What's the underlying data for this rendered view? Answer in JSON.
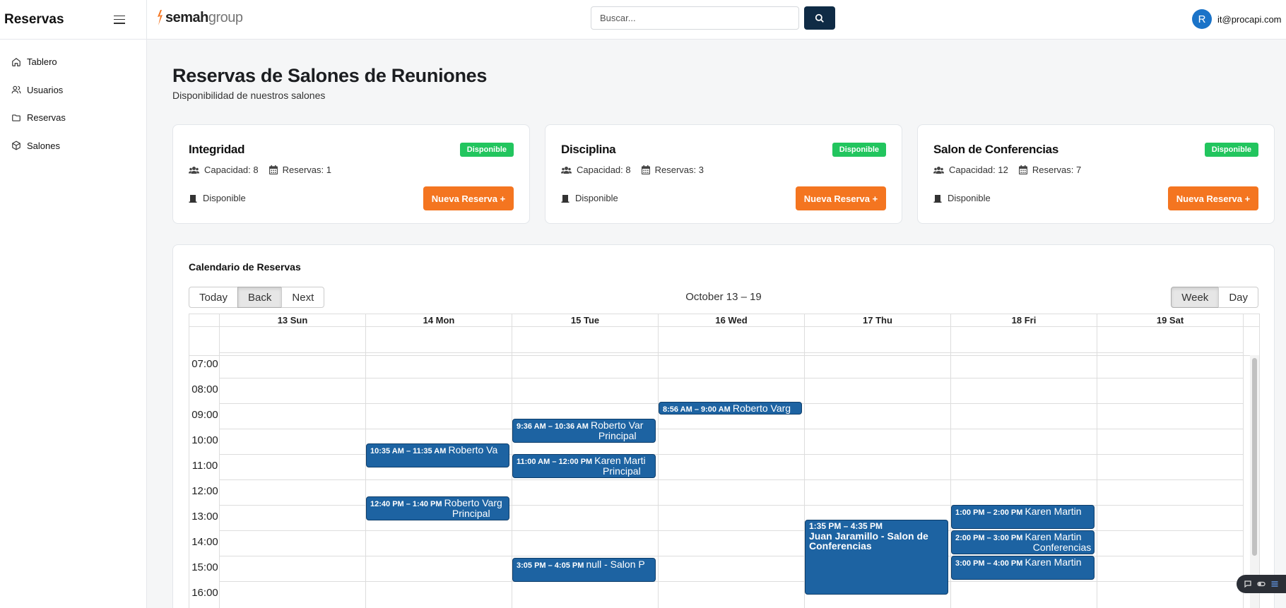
{
  "sidebar": {
    "title": "Reservas",
    "items": [
      {
        "label": "Tablero",
        "icon": "home-icon"
      },
      {
        "label": "Usuarios",
        "icon": "users-icon"
      },
      {
        "label": "Reservas",
        "icon": "folder-icon"
      },
      {
        "label": "Salones",
        "icon": "cube-icon"
      }
    ]
  },
  "topbar": {
    "logo_bold": "semah",
    "logo_light": "group",
    "search_placeholder": "Buscar...",
    "user_initial": "R",
    "user_email": "it@procapi.com"
  },
  "main": {
    "title": "Reservas de Salones de Reuniones",
    "subtitle": "Disponibilidad de nuestros salones"
  },
  "rooms": [
    {
      "name": "Integridad",
      "badge": "Disponible",
      "capacity": "Capacidad: 8",
      "reservations": "Reservas: 1",
      "status": "Disponible",
      "button": "Nueva Reserva +"
    },
    {
      "name": "Disciplina",
      "badge": "Disponible",
      "capacity": "Capacidad: 8",
      "reservations": "Reservas: 3",
      "status": "Disponible",
      "button": "Nueva Reserva +"
    },
    {
      "name": "Salon de Conferencias",
      "badge": "Disponible",
      "capacity": "Capacidad: 12",
      "reservations": "Reservas: 7",
      "status": "Disponible",
      "button": "Nueva Reserva +"
    }
  ],
  "calendar": {
    "title": "Calendario de Reservas",
    "nav_buttons": [
      "Today",
      "Back",
      "Next"
    ],
    "range": "October 13 – 19",
    "view_buttons": [
      "Week",
      "Day"
    ],
    "active_view": "Week",
    "days": [
      "13 Sun",
      "14 Mon",
      "15 Tue",
      "16 Wed",
      "17 Thu",
      "18 Fri",
      "19 Sat"
    ],
    "hours": [
      "07:00",
      "08:00",
      "09:00",
      "10:00",
      "11:00",
      "12:00",
      "13:00",
      "14:00",
      "15:00",
      "16:00"
    ],
    "events": [
      {
        "day": 3,
        "start": 8.933,
        "end": 9.5,
        "time": "8:56 AM – 9:00 AM",
        "title": "Roberto Varg",
        "style": "inline"
      },
      {
        "day": 2,
        "start": 9.6,
        "end": 10.6,
        "time": "9:36 AM – 10:36 AM",
        "title": "Roberto Var",
        "title2": "Principal",
        "style": "inline"
      },
      {
        "day": 1,
        "start": 10.583,
        "end": 11.583,
        "time": "10:35 AM – 11:35 AM",
        "title": "Roberto Va",
        "style": "inline"
      },
      {
        "day": 2,
        "start": 11.0,
        "end": 12.0,
        "time": "11:00 AM – 12:00 PM",
        "title": "Karen Marti",
        "title2": "Principal",
        "style": "inline"
      },
      {
        "day": 1,
        "start": 12.667,
        "end": 13.667,
        "time": "12:40 PM – 1:40 PM",
        "title": "Roberto Varg",
        "title2": "Principal",
        "style": "inline"
      },
      {
        "day": 4,
        "start": 13.583,
        "end": 16.583,
        "time": "1:35 PM – 4:35 PM",
        "title": "Juan Jaramillo - Salon de Conferencias",
        "style": "tall"
      },
      {
        "day": 5,
        "start": 13.0,
        "end": 14.0,
        "time": "1:00 PM – 2:00 PM",
        "title": "Karen Martin",
        "style": "inline"
      },
      {
        "day": 5,
        "start": 14.0,
        "end": 15.0,
        "time": "2:00 PM – 3:00 PM",
        "title": "Karen Martin",
        "title2": "Conferencias",
        "style": "inline"
      },
      {
        "day": 5,
        "start": 15.0,
        "end": 16.0,
        "time": "3:00 PM – 4:00 PM",
        "title": "Karen Martin",
        "style": "inline"
      },
      {
        "day": 2,
        "start": 15.083,
        "end": 16.083,
        "time": "3:05 PM – 4:05 PM",
        "title": "null - Salon P",
        "style": "inline"
      }
    ]
  },
  "colors": {
    "accent_orange": "#f47520",
    "badge_green": "#22c55e",
    "event_blue": "#1d63a2",
    "search_btn": "#0f2b45",
    "avatar_blue": "#1a73c8"
  }
}
